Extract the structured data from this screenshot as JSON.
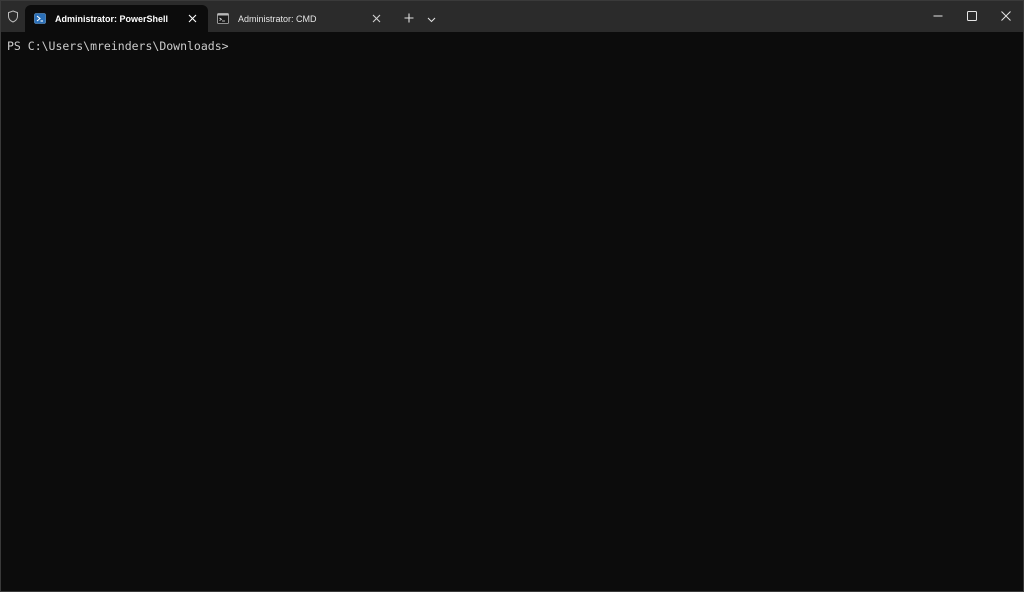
{
  "tabs": [
    {
      "title": "Administrator: PowerShell",
      "icon": "powershell-icon",
      "active": true
    },
    {
      "title": "Administrator: CMD",
      "icon": "cmd-icon",
      "active": false
    }
  ],
  "terminal": {
    "prompt": "PS C:\\Users\\mreinders\\Downloads>"
  },
  "icons": {
    "admin": "shield-icon",
    "new_tab": "plus-icon",
    "dropdown": "chevron-down-icon",
    "minimize": "minimize-icon",
    "maximize": "maximize-icon",
    "close": "close-icon"
  },
  "colors": {
    "titlebar": "#2b2b2b",
    "terminal_background": "#0c0c0c",
    "text": "#cccccc"
  }
}
